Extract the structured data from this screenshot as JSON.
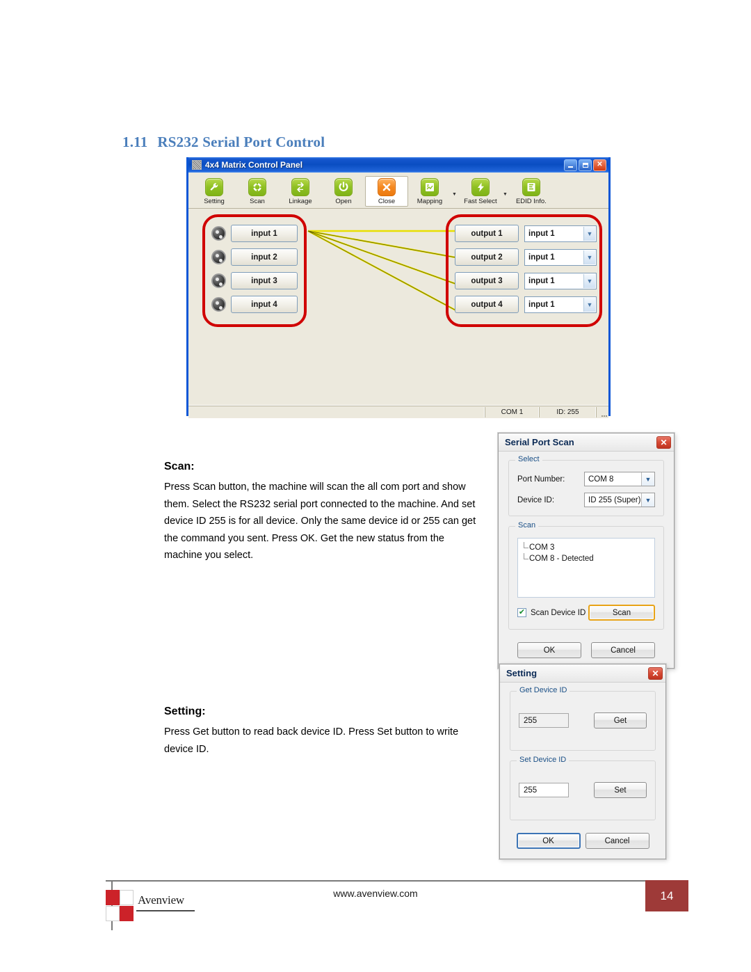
{
  "section": {
    "number": "1.11",
    "title": "RS232 Serial Port Control"
  },
  "app_window": {
    "title": "4x4 Matrix Control Panel",
    "titlebar_icon": "matrix-app-icon",
    "window_buttons": {
      "minimize": "minimize-icon",
      "maximize": "maximize-icon",
      "close": "✕"
    },
    "toolbar": [
      {
        "label": "Setting",
        "icon": "wrench-icon",
        "selected": false,
        "dropdown": false
      },
      {
        "label": "Scan",
        "icon": "refresh-icon",
        "selected": false,
        "dropdown": false
      },
      {
        "label": "Linkage",
        "icon": "link-arrows-icon",
        "selected": false,
        "dropdown": false
      },
      {
        "label": "Open",
        "icon": "power-icon",
        "selected": false,
        "dropdown": false
      },
      {
        "label": "Close",
        "icon": "close-x-icon",
        "selected": true,
        "dropdown": false
      },
      {
        "label": "Mapping",
        "icon": "mapping-icon",
        "selected": false,
        "dropdown": true
      },
      {
        "label": "Fast Select",
        "icon": "lightning-icon",
        "selected": false,
        "dropdown": true
      },
      {
        "label": "EDID Info.",
        "icon": "edid-icon",
        "selected": false,
        "dropdown": false
      }
    ],
    "inputs": [
      {
        "label": "input 1"
      },
      {
        "label": "input 2"
      },
      {
        "label": "input 3"
      },
      {
        "label": "input 4"
      }
    ],
    "outputs": [
      {
        "label": "output 1",
        "selected_source": "input 1"
      },
      {
        "label": "output 2",
        "selected_source": "input 1"
      },
      {
        "label": "output 3",
        "selected_source": "input 1"
      },
      {
        "label": "output 4",
        "selected_source": "input 1"
      }
    ],
    "routing_lines_color": "#e8e000",
    "group_border_color": "#d00000",
    "statusbar": {
      "port": "COM 1",
      "device_id": "ID: 255"
    }
  },
  "scan_section": {
    "heading": "Scan:",
    "paragraph": "Press Scan button, the machine will scan the all com port and show them. Select the RS232 serial port connected to the machine. And set device ID 255 is for all device. Only the same device id or 255 can get the command you sent. Press OK. Get the new status from the machine you select."
  },
  "setting_section": {
    "heading": "Setting:",
    "paragraph": "Press Get button to read back device ID. Press Set button to write device ID."
  },
  "scan_dialog": {
    "title": "Serial Port Scan",
    "close_glyph": "✕",
    "select_group": {
      "label": "Select",
      "port_number_label": "Port Number:",
      "port_number_value": "COM 8",
      "device_id_label": "Device ID:",
      "device_id_value": "ID 255 (Super)"
    },
    "scan_group": {
      "label": "Scan",
      "results": [
        "COM 3",
        "COM 8 - Detected"
      ],
      "checkbox_label": "Scan Device ID",
      "checkbox_checked": true,
      "check_glyph": "✔",
      "scan_button": "Scan"
    },
    "ok_button": "OK",
    "cancel_button": "Cancel"
  },
  "setting_dialog": {
    "title": "Setting",
    "close_glyph": "✕",
    "get_group": {
      "label": "Get Device ID",
      "value": "255",
      "button": "Get"
    },
    "set_group": {
      "label": "Set Device ID",
      "value": "255",
      "button": "Set"
    },
    "ok_button": "OK",
    "cancel_button": "Cancel"
  },
  "footer": {
    "logo_text": "Avenview",
    "url": "www.avenview.com",
    "page_number": "14"
  }
}
